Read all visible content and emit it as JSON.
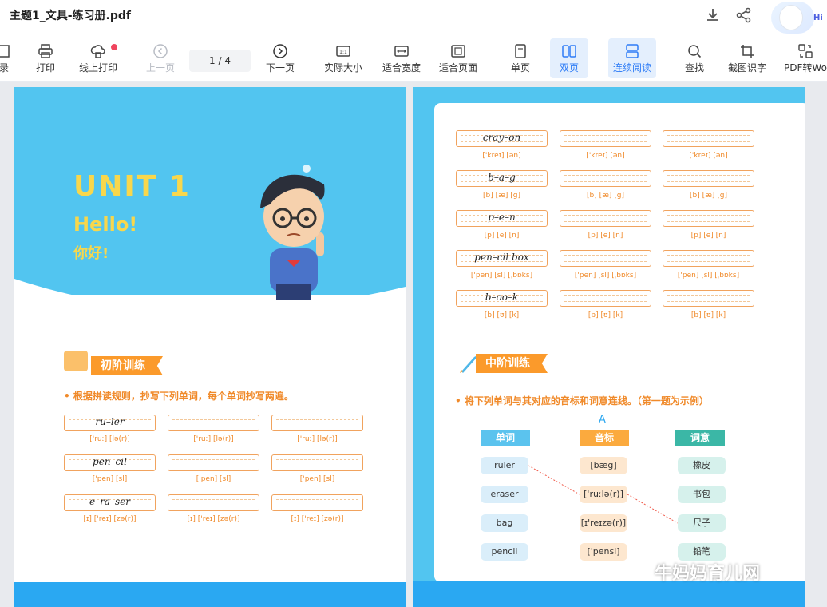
{
  "window": {
    "title": "主题1_文具-练习册.pdf",
    "avatar_text": "Hi"
  },
  "toolbar": {
    "items": [
      {
        "label": "录",
        "icon": "catalog-icon"
      },
      {
        "label": "打印",
        "icon": "printer-icon"
      },
      {
        "label": "线上打印",
        "icon": "cloud-print-icon"
      },
      {
        "label": "上一页",
        "icon": "prev-page-icon"
      },
      {
        "label": "下一页",
        "icon": "next-page-icon"
      },
      {
        "label": "实际大小",
        "icon": "actual-size-icon"
      },
      {
        "label": "适合宽度",
        "icon": "fit-width-icon"
      },
      {
        "label": "适合页面",
        "icon": "fit-page-icon"
      },
      {
        "label": "单页",
        "icon": "single-page-icon"
      },
      {
        "label": "双页",
        "icon": "double-page-icon"
      },
      {
        "label": "连续阅读",
        "icon": "continuous-read-icon"
      },
      {
        "label": "查找",
        "icon": "search-icon"
      },
      {
        "label": "截图识字",
        "icon": "screenshot-ocr-icon"
      },
      {
        "label": "PDF转Wo",
        "icon": "pdf-to-word-icon"
      }
    ],
    "page_indicator": "1  / 4",
    "online_print_badge_color": "#f0455e"
  },
  "left_page": {
    "unit_title": "UNIT 1",
    "hello": "Hello!",
    "nihao": "你好!",
    "section_title": "初阶训练",
    "instruction": "根据拼读规则，抄写下列单词，每个单词抄写两遍。",
    "rows": [
      {
        "word": "ru–ler",
        "phonetic": "['ruː] [lə(r)]"
      },
      {
        "word": "pen–cil",
        "phonetic": "['pen] [sl]"
      },
      {
        "word": "e–ra–ser",
        "phonetic": "[ɪ] ['reɪ] [zə(r)]"
      }
    ]
  },
  "right_page": {
    "rows": [
      {
        "word": "cray–on",
        "phonetic": "['kreɪ] [ən]"
      },
      {
        "word": "b–a–g",
        "phonetic": "[b] [æ] [g]"
      },
      {
        "word": "p–e–n",
        "phonetic": "[p] [e] [n]"
      },
      {
        "word": "pen–cil box",
        "phonetic": "['pen] [sl] [ˌbɒks]"
      },
      {
        "word": "b–oo–k",
        "phonetic": "[b] [ʊ] [k]"
      }
    ],
    "section_title": "中阶训练",
    "instruction": "将下列单词与其对应的音标和词意连线。（第一题为示例）",
    "mark": "A",
    "headers": {
      "words": "单词",
      "phonetics": "音标",
      "meanings": "词意"
    },
    "words": [
      "ruler",
      "eraser",
      "bag",
      "pencil"
    ],
    "phonetics": [
      "[bæg]",
      "['ruːlə(r)]",
      "[ɪ'reɪzə(r)]",
      "['pensl]"
    ],
    "meanings": [
      "橡皮",
      "书包",
      "尺子",
      "铅笔"
    ]
  },
  "watermark": "牛妈妈育儿网",
  "colors": {
    "page_blue": "#52c5f0",
    "accent_yellow": "#f8d74c",
    "accent_orange": "#fb9a2b",
    "active_blue": "#2e7cf6"
  }
}
